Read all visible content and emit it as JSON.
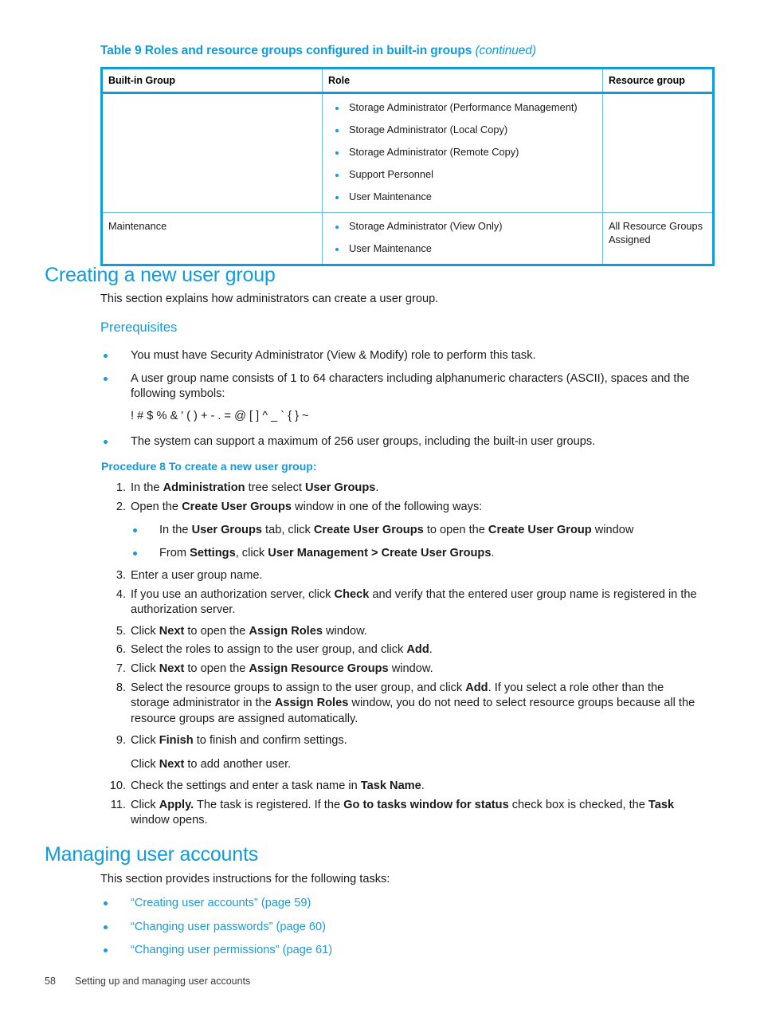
{
  "colors": {
    "accent": "#0f9bdc",
    "bullet": "#1c9ad6",
    "text": "#1a1a1a"
  },
  "table": {
    "caption_main": "Table 9 Roles and resource groups configured in built-in groups",
    "caption_continued": "(continued)",
    "headers": [
      "Built-in Group",
      "Role",
      "Resource group"
    ],
    "rows": [
      {
        "group": "",
        "roles": [
          "Storage Administrator (Performance Management)",
          "Storage Administrator (Local Copy)",
          "Storage Administrator (Remote Copy)",
          "Support Personnel",
          "User Maintenance"
        ],
        "resource_group": ""
      },
      {
        "group": "Maintenance",
        "roles": [
          "Storage Administrator (View Only)",
          "User Maintenance"
        ],
        "resource_group": "All Resource Groups Assigned"
      }
    ]
  },
  "section_creating": {
    "heading": "Creating a new user group",
    "intro": "This section explains how administrators can create a user group.",
    "prerequisites_heading": "Prerequisites",
    "prerequisites": [
      "You must have Security Administrator (View & Modify) role to perform this task.",
      "A user group name consists of 1 to 64 characters including alphanumeric characters (ASCII), spaces and the following symbols:",
      "The system can support a maximum of 256 user groups, including the built-in user groups."
    ],
    "symbols_line": "! # $ % & ' ( ) + - . = @ [ ] ^ _ ` { } ~",
    "procedure_heading": "Procedure 8 To create a new user group:",
    "steps": [
      {
        "num": "1.",
        "text_html": "In the <b>Administration</b> tree select <b>User Groups</b>."
      },
      {
        "num": "2.",
        "text_html": "Open the <b>Create User Groups</b> window in one of the following ways:"
      },
      {
        "num": "3.",
        "text_html": "Enter a user group name."
      },
      {
        "num": "4.",
        "text_html": "If you use an authorization server, click <b>Check</b> and verify that the entered user group name is registered in the authorization server."
      },
      {
        "num": "5.",
        "text_html": "Click <b>Next</b> to open the <b>Assign Roles</b> window."
      },
      {
        "num": "6.",
        "text_html": "Select the roles to assign to the user group, and click <b>Add</b>."
      },
      {
        "num": "7.",
        "text_html": "Click <b>Next</b> to open the <b>Assign Resource Groups</b> window."
      },
      {
        "num": "8.",
        "text_html": "Select the resource groups to assign to the user group, and click <b>Add</b>. If you select a role other than the storage administrator in the <b>Assign Roles</b> window, you do not need to select resource groups because all the resource groups are assigned automatically."
      },
      {
        "num": "9.",
        "text_html": "Click <b>Finish</b> to finish and confirm settings.",
        "continuation_html": "Click <b>Next</b> to add another user."
      },
      {
        "num": "10.",
        "text_html": "Check the settings and enter a task name in <b>Task Name</b>."
      },
      {
        "num": "11.",
        "text_html": "Click <b>Apply.</b> The task is registered. If the <b>Go to tasks window for status</b> check box is checked, the <b>Task</b> window opens."
      }
    ],
    "step2_substeps": [
      "In the <b>User Groups</b> tab, click <b>Create User Groups</b> to open the <b>Create User Group</b> window",
      "From <b>Settings</b>, click <b>User Management &gt; Create User Groups</b>."
    ]
  },
  "section_managing": {
    "heading": "Managing user accounts",
    "intro": "This section provides instructions for the following tasks:",
    "links": [
      "“Creating user accounts” (page 59)",
      "“Changing user passwords” (page 60)",
      "“Changing user permissions” (page 61)"
    ]
  },
  "footer": {
    "page_number": "58",
    "chapter_title": "Setting up and managing user accounts"
  }
}
